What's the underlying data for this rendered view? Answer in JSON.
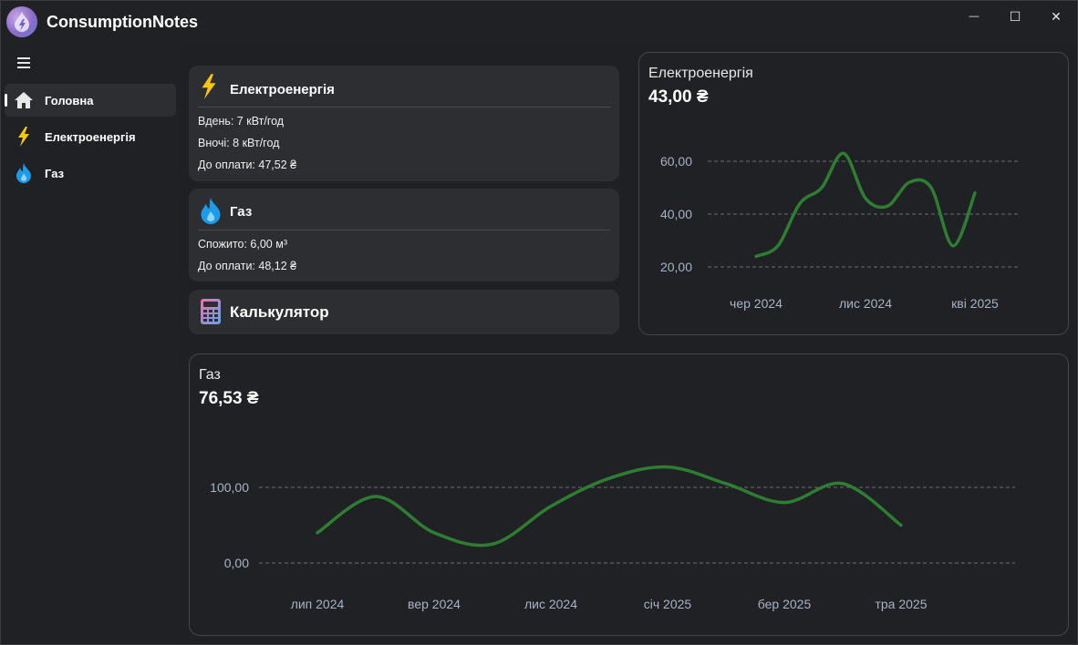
{
  "app": {
    "title": "ConsumptionNotes"
  },
  "window_controls": {
    "minimize": "—",
    "maximize": "☐",
    "close": "✕"
  },
  "sidebar": {
    "items": [
      {
        "label": "Головна",
        "icon": "home-icon",
        "active": true
      },
      {
        "label": "Електроенергія",
        "icon": "lightning-icon",
        "active": false
      },
      {
        "label": "Газ",
        "icon": "flame-icon",
        "active": false
      }
    ]
  },
  "cards": {
    "electricity": {
      "title": "Електроенергія",
      "lines": [
        "Вдень: 7 кВт/год",
        "Вночі: 8 кВт/год",
        "До оплати: 47,52 ₴"
      ]
    },
    "gas": {
      "title": "Газ",
      "lines": [
        "Спожито: 6,00 м³",
        "До оплати: 48,12 ₴"
      ]
    },
    "calculator": {
      "title": "Калькулятор"
    }
  },
  "colors": {
    "line": "#2e7d32",
    "grid": "#6b6c70",
    "axis_text": "#a8b3c4",
    "background": "#202124",
    "card": "#2d2e31"
  },
  "chart_data": [
    {
      "type": "line",
      "title": "Електроенергія",
      "value_label": "43,00 ₴",
      "x": [
        "2024-06",
        "2024-07",
        "2024-08",
        "2024-09",
        "2024-10",
        "2024-11",
        "2024-12",
        "2025-01",
        "2025-02",
        "2025-03",
        "2025-04"
      ],
      "x_tick_labels": [
        "чер 2024",
        "лис 2024",
        "кві 2025"
      ],
      "x_tick_positions": [
        "2024-06",
        "2024-11",
        "2025-04"
      ],
      "y": [
        24,
        28,
        44,
        50,
        63,
        46,
        43,
        52,
        50,
        28,
        48
      ],
      "y_ticks": [
        20,
        40,
        60
      ],
      "y_tick_labels": [
        "20,00",
        "40,00",
        "60,00"
      ],
      "ylim": [
        20,
        60
      ],
      "grid": "horizontal dashed"
    },
    {
      "type": "line",
      "title": "Газ",
      "value_label": "76,53 ₴",
      "x": [
        "2024-07",
        "2024-08",
        "2024-09",
        "2024-10",
        "2024-11",
        "2024-12",
        "2025-01",
        "2025-02",
        "2025-03",
        "2025-04",
        "2025-05"
      ],
      "x_tick_labels": [
        "лип 2024",
        "вер 2024",
        "лис 2024",
        "січ 2025",
        "бер 2025",
        "тра 2025"
      ],
      "x_tick_positions": [
        "2024-07",
        "2024-09",
        "2024-11",
        "2025-01",
        "2025-03",
        "2025-05"
      ],
      "y": [
        40,
        88,
        40,
        25,
        75,
        112,
        127,
        105,
        80,
        105,
        50
      ],
      "y_ticks": [
        0,
        100
      ],
      "y_tick_labels": [
        "0,00",
        "100,00"
      ],
      "ylim": [
        0,
        100
      ],
      "grid": "horizontal dashed"
    }
  ]
}
